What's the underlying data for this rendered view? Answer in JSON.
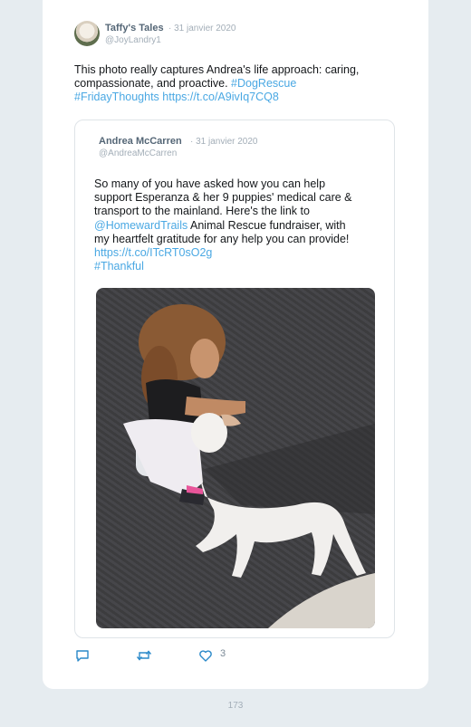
{
  "tweet": {
    "author_name": "Taffy's Tales",
    "date": "· 31 janvier 2020",
    "handle": "@JoyLandry1",
    "text_plain": "This photo really captures Andrea's life approach: caring, compassionate, and proactive. ",
    "hashtag_1": "#DogRescue",
    "hashtag_2": "#FridayThoughts",
    "link": "https://t.co/A9ivIq7CQ8"
  },
  "quoted_tweet": {
    "author_name": "Andrea McCarren",
    "date": "· 31 janvier 2020",
    "handle": "@AndreaMcCarren",
    "line_1": "So many of you have asked how you can help",
    "line_2": "support Esperanza & her 9 puppies' medical care &",
    "line_3": "transport to the mainland. Here's the link to",
    "mention": "@HomewardTrails",
    "line_4_rest": " Animal Rescue fundraiser, with",
    "line_5": "my heartfelt gratitude for any help you can provide!",
    "link": "https://t.co/ITcRT0sO2g",
    "hashtag": "#Thankful"
  },
  "actions": {
    "like_count": "3"
  },
  "page_number": "173",
  "colors": {
    "link": "#4aa8e3",
    "background": "#e6ecf0",
    "muted": "#a3aeb8"
  }
}
